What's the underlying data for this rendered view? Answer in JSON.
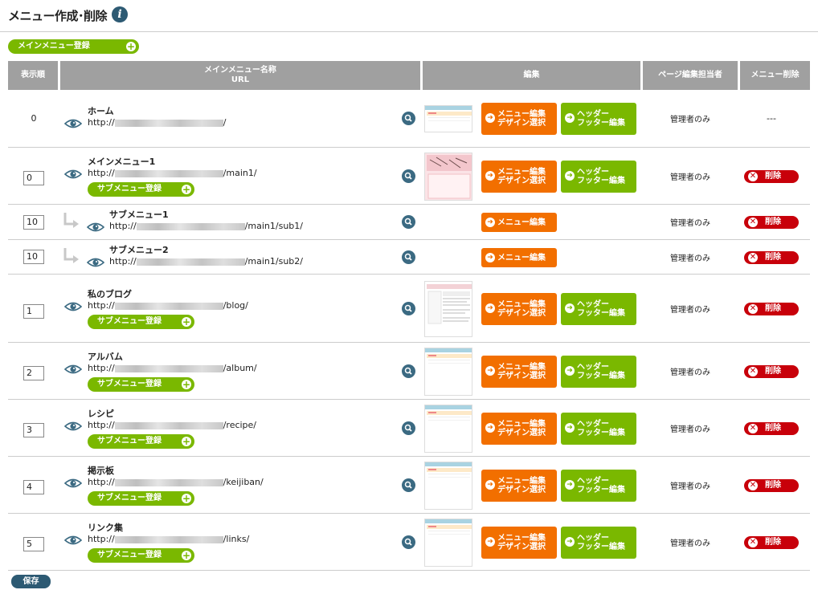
{
  "title": "メニュー作成･削除",
  "info_icon": "i",
  "main_register_label": "メインメニュー登録",
  "sub_register_label": "サブメニュー登録",
  "columns": {
    "order": "表示順",
    "name_line1": "メインメニュー名称",
    "name_line2": "URL",
    "edit": "編集",
    "page_editor": "ページ編集担当者",
    "delete": "メニュー削除"
  },
  "buttons": {
    "menu_edit_line1": "メニュー編集",
    "menu_edit_line2": "デザイン選択",
    "menu_edit_single": "メニュー編集",
    "header_line1": "ヘッダー",
    "header_line2": "フッター編集",
    "delete": "削除",
    "save": "保存"
  },
  "rows": [
    {
      "order": "0",
      "name": "ホーム",
      "url_prefix": "http://",
      "url_suffix": "/",
      "manager": "管理者のみ",
      "delete": "---"
    },
    {
      "order": "0",
      "name": "メインメニュー1",
      "url_prefix": "http://",
      "url_suffix": "/main1/",
      "manager": "管理者のみ"
    },
    {
      "order": "10",
      "name": "サブメニュー1",
      "url_prefix": "http://",
      "url_suffix": "/main1/sub1/",
      "manager": "管理者のみ"
    },
    {
      "order": "10",
      "name": "サブメニュー2",
      "url_prefix": "http://",
      "url_suffix": "/main1/sub2/",
      "manager": "管理者のみ"
    },
    {
      "order": "1",
      "name": "私のブログ",
      "url_prefix": "http://",
      "url_suffix": "/blog/",
      "manager": "管理者のみ"
    },
    {
      "order": "2",
      "name": "アルバム",
      "url_prefix": "http://",
      "url_suffix": "/album/",
      "manager": "管理者のみ"
    },
    {
      "order": "3",
      "name": "レシピ",
      "url_prefix": "http://",
      "url_suffix": "/recipe/",
      "manager": "管理者のみ"
    },
    {
      "order": "4",
      "name": "掲示板",
      "url_prefix": "http://",
      "url_suffix": "/keijiban/",
      "manager": "管理者のみ"
    },
    {
      "order": "5",
      "name": "リンク集",
      "url_prefix": "http://",
      "url_suffix": "/links/",
      "manager": "管理者のみ"
    }
  ],
  "colors": {
    "green": "#7ab800",
    "orange": "#f26f00",
    "red": "#c8000a",
    "navy": "#2d5a73",
    "header_gray": "#a0a0a0"
  }
}
